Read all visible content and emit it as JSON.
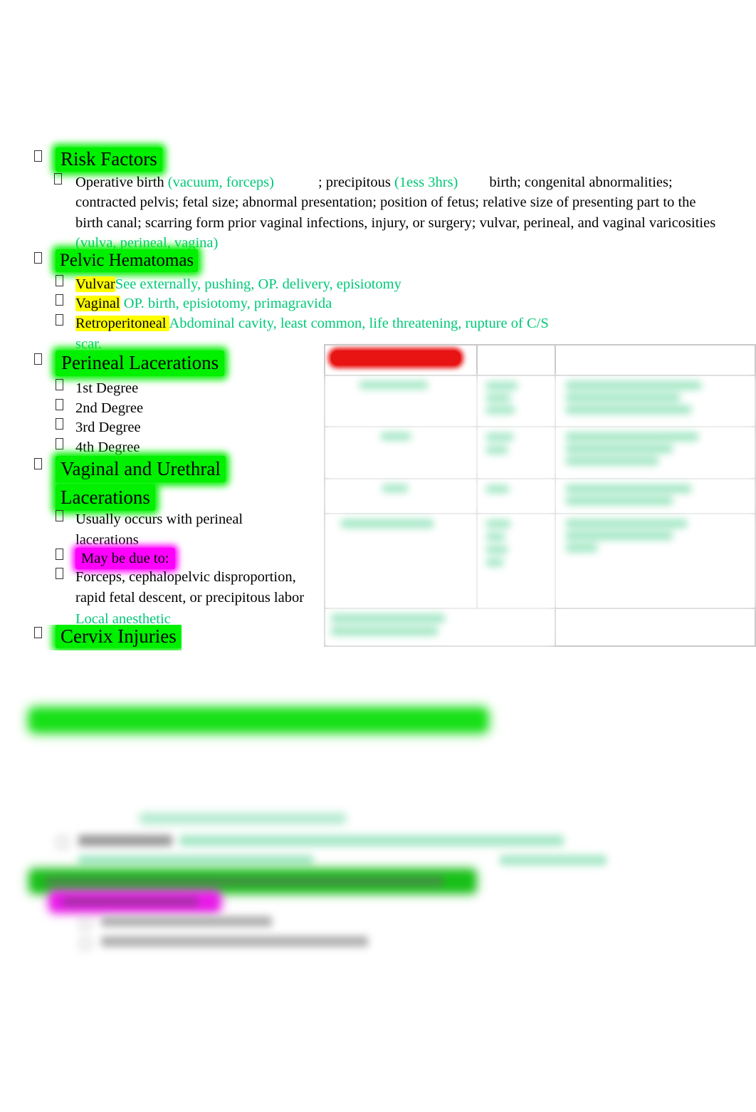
{
  "document": {
    "type": "lecture-outline",
    "topic": "Obstetric lacerations and hematomas"
  },
  "colors": {
    "accent_green_text": "#00c878",
    "highlight_green": "#00f000",
    "highlight_yellow": "#ffff00",
    "highlight_magenta": "#ff00ff",
    "highlight_red": "#e81414",
    "table_border": "#c9c9c9"
  },
  "outline": {
    "risk_factors": {
      "heading": "Risk Factors",
      "body_parts": {
        "p1": " Operative birth ",
        "p2_green": "(vacuum, forceps)",
        "p3": "; precipitous ",
        "p4_green": "(1ess 3hrs)",
        "p5": "birth; congenital abnormalities;",
        "line2": "contracted pelvis; fetal size; abnormal presentation; position of fetus; relative size of presenting part to the",
        "line3": "birth canal; scarring form prior vaginal infections, injury, or surgery; vulvar, perineal, and vaginal varicosities",
        "line4_green": "(vulva, perineal, vagina)"
      }
    },
    "pelvic_hematomas": {
      "heading": "Pelvic Hematomas",
      "items": [
        {
          "term": "Vulvar",
          "detail": "See externally, pushing, OP. delivery, episiotomy"
        },
        {
          "term": "Vaginal",
          "detail": "OP. birth, episiotomy, primagravida"
        },
        {
          "term": " Retroperitoneal ",
          "detail": "Abdominal cavity, least common, life threatening, rupture of C/S",
          "detail_wrap": "scar."
        }
      ]
    },
    "perineal_lacerations": {
      "heading": " Perineal Lacerations",
      "items": [
        "1st Degree",
        "2nd Degree",
        "3rd Degree",
        "4th Degree"
      ]
    },
    "vaginal_urethral_lacerations": {
      "heading_line1": "Vaginal and Urethral",
      "heading_line2": "Lacerations",
      "item1_line1": "Usually occurs with perineal",
      "item1_line2": "lacerations",
      "item2": "May be due to:",
      "item3_line1": "Forceps, cephalopelvic disproportion,",
      "item3_line2": "rapid fetal descent, or precipitous labor",
      "item3_line3_green": "Local anesthetic"
    },
    "cervix_injuries": {
      "heading": "Cervix Injuries"
    }
  },
  "table": {
    "caption_status": "illegible-blurred",
    "rows": [
      {
        "c1": "",
        "c2": "",
        "c3": "",
        "header_bar": true
      },
      {
        "c1": "",
        "c2": "",
        "c3": ""
      },
      {
        "c1": "",
        "c2": "",
        "c3": ""
      },
      {
        "c1": "",
        "c2": "",
        "c3": ""
      },
      {
        "c1": "",
        "c2": "",
        "c3": ""
      },
      {
        "c1": "",
        "c2": "",
        "c3": "",
        "merged": true
      }
    ]
  },
  "lower_section": {
    "status": "out-of-focus",
    "note": "Blurred, illegible text blocks with green and magenta highlight bars"
  }
}
